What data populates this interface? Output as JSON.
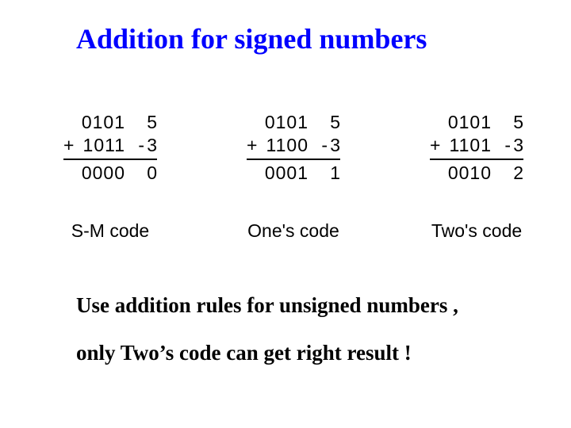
{
  "title": "Addition for signed numbers",
  "examples": [
    {
      "label": "S-M code",
      "op1_bin": "0101",
      "op1_dec_sign": "",
      "op1_dec": "5",
      "plus": "+",
      "op2_bin": "1011",
      "op2_dec_sign": "-",
      "op2_dec": "3",
      "res_bin": "0000",
      "res_dec_sign": "",
      "res_dec": "0"
    },
    {
      "label": "One's code",
      "op1_bin": "0101",
      "op1_dec_sign": "",
      "op1_dec": "5",
      "plus": "+",
      "op2_bin": "1100",
      "op2_dec_sign": "-",
      "op2_dec": "3",
      "res_bin": "0001",
      "res_dec_sign": "",
      "res_dec": "1"
    },
    {
      "label": "Two's code",
      "op1_bin": "0101",
      "op1_dec_sign": "",
      "op1_dec": "5",
      "plus": "+",
      "op2_bin": "1101",
      "op2_dec_sign": "-",
      "op2_dec": "3",
      "res_bin": "0010",
      "res_dec_sign": "",
      "res_dec": "2"
    }
  ],
  "body": {
    "line1": "Use addition rules for unsigned numbers ,",
    "line2": "only Two’s code can get right result !"
  }
}
